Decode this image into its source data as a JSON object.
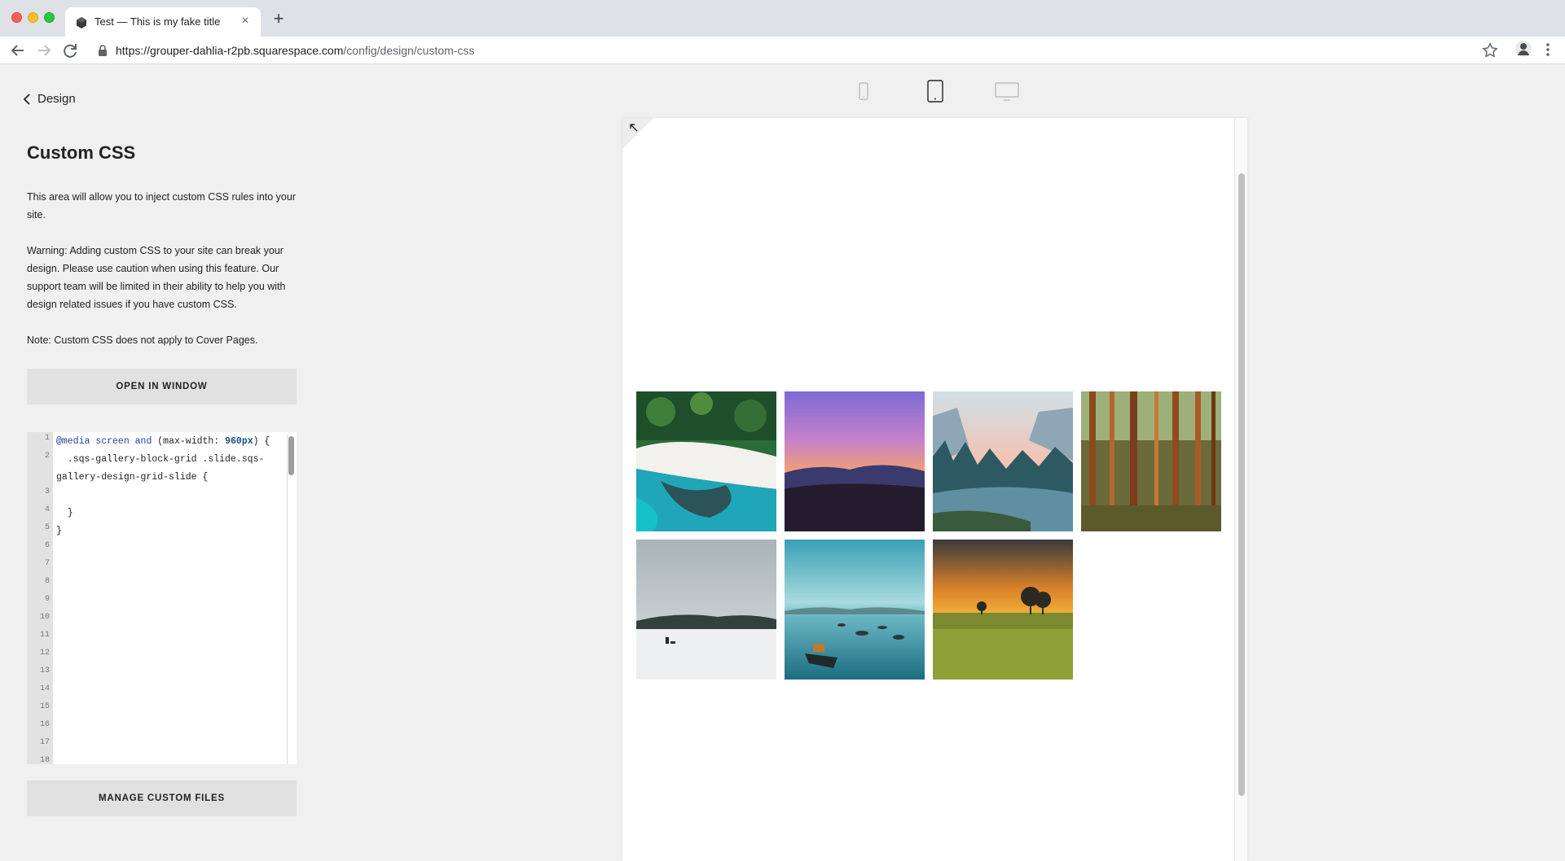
{
  "browser": {
    "tab_title": "Test — This is my fake title",
    "url_host": "https://grouper-dahlia-r2pb.squarespace.com",
    "url_path": "/config/design/custom-css",
    "icons": [
      "back-arrow-icon",
      "forward-arrow-icon",
      "reload-icon",
      "lock-icon",
      "bookmark-star-icon",
      "profile-avatar-icon",
      "more-menu-icon",
      "new-tab-plus-icon",
      "tab-close-icon"
    ]
  },
  "panel": {
    "back_label": "Design",
    "title": "Custom CSS",
    "description": "This area will allow you to inject custom CSS rules into your site.",
    "warning": "Warning: Adding custom CSS to your site can break your design. Please use caution when using this feature. Our support team will be limited in their ability to help you with design related issues if you have custom CSS.",
    "note": "Note: Custom CSS does not apply to Cover Pages.",
    "open_button": "OPEN IN WINDOW",
    "manage_button": "MANAGE CUSTOM FILES"
  },
  "editor": {
    "line_numbers": [
      "1",
      "2",
      "",
      "3",
      "4",
      "5",
      "6",
      "7",
      "8",
      "9",
      "10",
      "11",
      "12",
      "13",
      "14",
      "15",
      "16",
      "17",
      "18"
    ],
    "code": {
      "l1_at": "@media",
      "l1_kw1": "screen",
      "l1_kw2": "and",
      "l1_open": "(max-width:",
      "l1_num": "960px",
      "l1_close": ") {",
      "l2": "  .sqs-gallery-block-grid .slide.sqs-",
      "l2b": "gallery-design-grid-slide {",
      "l3": "",
      "l4": "  }",
      "l5": "}"
    }
  },
  "preview": {
    "device_modes": [
      "mobile",
      "tablet",
      "desktop"
    ],
    "active_device": "tablet",
    "gallery_images": [
      "aerial-beach-coast",
      "purple-mountain-sunset",
      "yosemite-valley-river",
      "pine-forest",
      "snowy-field-dogsled",
      "harbor-boats",
      "savanna-sunset"
    ]
  }
}
